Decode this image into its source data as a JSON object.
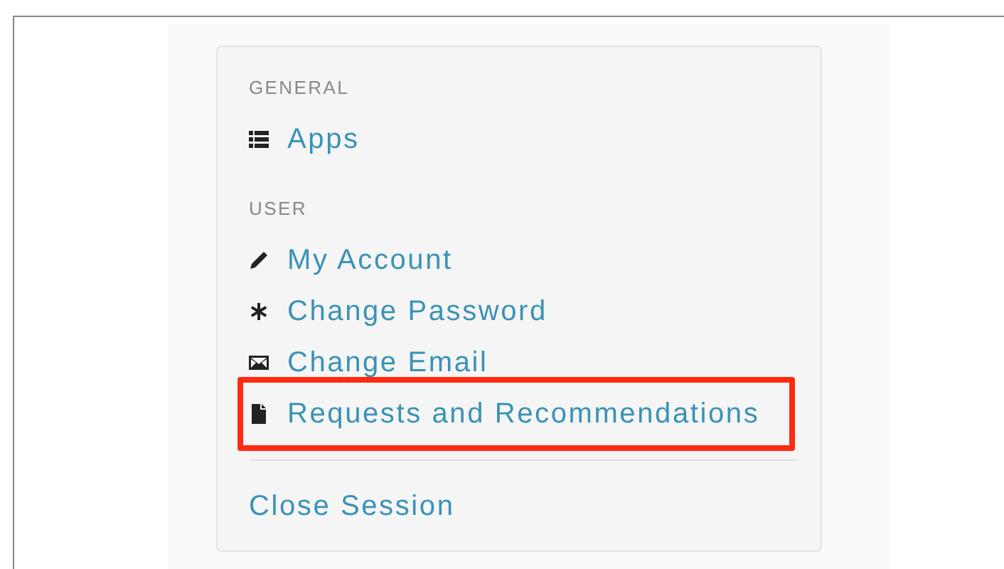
{
  "sections": [
    {
      "header": "GENERAL",
      "items": [
        {
          "label": "Apps",
          "kind": "list",
          "highlighted": false
        }
      ]
    },
    {
      "header": "USER",
      "items": [
        {
          "label": "My Account",
          "kind": "pencil",
          "highlighted": false
        },
        {
          "label": "Change Password",
          "kind": "asterisk",
          "highlighted": false
        },
        {
          "label": "Change Email",
          "kind": "envelope",
          "highlighted": false
        },
        {
          "label": "Requests and Recommendations",
          "kind": "file",
          "highlighted": true
        }
      ]
    }
  ],
  "footer_link": "Close Session"
}
